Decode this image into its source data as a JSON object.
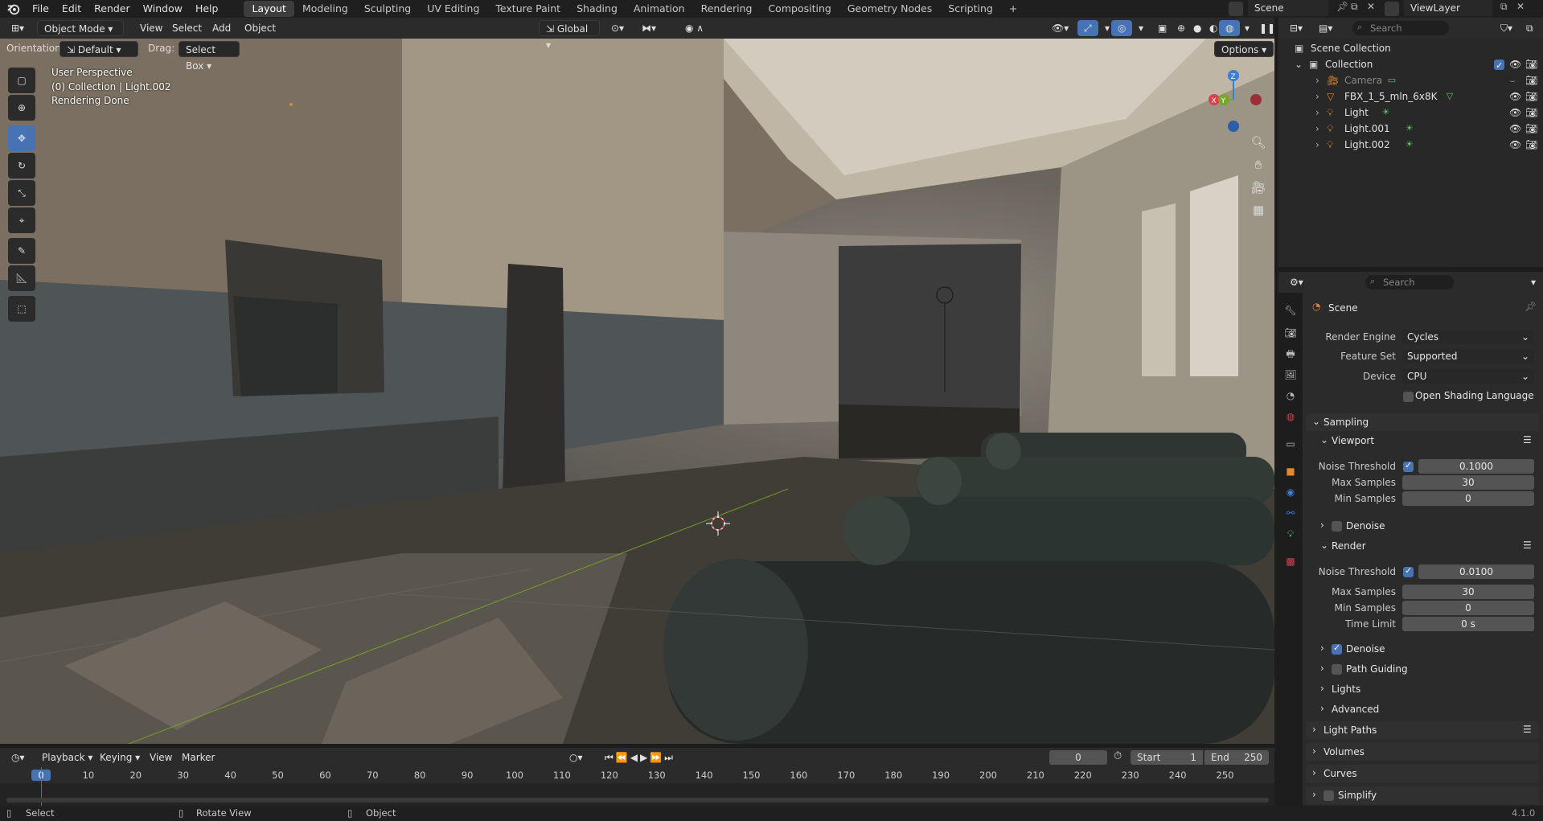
{
  "app": {
    "menus": [
      "File",
      "Edit",
      "Render",
      "Window",
      "Help"
    ],
    "workspaces": [
      "Layout",
      "Modeling",
      "Sculpting",
      "UV Editing",
      "Texture Paint",
      "Shading",
      "Animation",
      "Rendering",
      "Compositing",
      "Geometry Nodes",
      "Scripting"
    ],
    "active_workspace": "Layout",
    "scene_name": "Scene",
    "view_layer": "ViewLayer",
    "version": "4.1.0"
  },
  "viewport_header": {
    "mode": "Object Mode",
    "menus": [
      "View",
      "Select",
      "Add",
      "Object"
    ],
    "transform_orientation": "Global",
    "orientation_label": "Orientation:",
    "orientation_value": "Default",
    "drag_label": "Drag:",
    "drag_value": "Select Box",
    "options_label": "Options"
  },
  "viewport_info": {
    "line1": "User Perspective",
    "line2": "(0) Collection | Light.002",
    "line3": "Rendering Done"
  },
  "tools": [
    "select-box-icon",
    "cursor-icon",
    "move-icon",
    "rotate-icon",
    "scale-icon",
    "transform-icon",
    "annotate-icon",
    "measure-icon",
    "add-cube-icon"
  ],
  "gizmo": {
    "x": "X",
    "y": "Y",
    "z": "Z"
  },
  "outliner": {
    "search_placeholder": "Search",
    "scene_collection": "Scene Collection",
    "collection": "Collection",
    "items": [
      {
        "name": "Camera",
        "icon": "camera-icon",
        "muted": true
      },
      {
        "name": "FBX_1_5_mln_6x8K",
        "icon": "mesh-icon",
        "muted": false
      },
      {
        "name": "Light",
        "icon": "light-icon",
        "muted": false
      },
      {
        "name": "Light.001",
        "icon": "light-icon",
        "muted": false
      },
      {
        "name": "Light.002",
        "icon": "light-icon",
        "muted": false
      }
    ]
  },
  "properties": {
    "search_placeholder": "Search",
    "context": "Scene",
    "render_engine_label": "Render Engine",
    "render_engine": "Cycles",
    "feature_set_label": "Feature Set",
    "feature_set": "Supported",
    "device_label": "Device",
    "device": "CPU",
    "osl_label": "Open Shading Language",
    "sampling": "Sampling",
    "viewport": "Viewport",
    "noise_threshold_label": "Noise Threshold",
    "viewport_noise": "0.1000",
    "max_samples_label": "Max Samples",
    "viewport_max": "30",
    "min_samples_label": "Min Samples",
    "viewport_min": "0",
    "denoise": "Denoise",
    "render": "Render",
    "render_noise": "0.0100",
    "render_max": "30",
    "render_min": "0",
    "time_limit_label": "Time Limit",
    "time_limit": "0 s",
    "path_guiding": "Path Guiding",
    "lights": "Lights",
    "advanced": "Advanced",
    "light_paths": "Light Paths",
    "volumes": "Volumes",
    "curves": "Curves",
    "simplify": "Simplify"
  },
  "timeline": {
    "menus": [
      "Playback",
      "Keying",
      "View",
      "Marker"
    ],
    "current_frame": "0",
    "start_label": "Start",
    "start": "1",
    "end_label": "End",
    "end": "250",
    "ticks": [
      "0",
      "10",
      "20",
      "30",
      "40",
      "50",
      "60",
      "70",
      "80",
      "90",
      "100",
      "110",
      "120",
      "130",
      "140",
      "150",
      "160",
      "170",
      "180",
      "190",
      "200",
      "210",
      "220",
      "230",
      "240",
      "250"
    ]
  },
  "statusbar": {
    "select": "Select",
    "rotate": "Rotate View",
    "object": "Object"
  },
  "colors": {
    "accent": "#4772b3",
    "bg": "#1d1d1d",
    "panel": "#2b2b2b",
    "field": "#545454",
    "x_axis": "#d9414e",
    "y_axis": "#7aa52b",
    "z_axis": "#3a7ddb",
    "light_icon": "#5fc46a",
    "object_icon": "#e0872f"
  }
}
